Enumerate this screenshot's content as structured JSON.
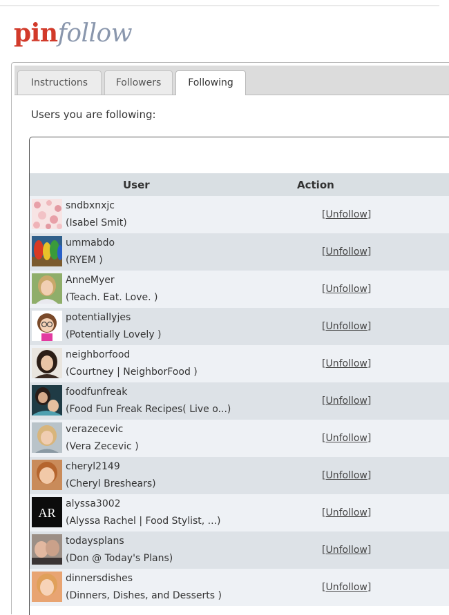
{
  "logo": {
    "part1": "pin",
    "part2": "follow"
  },
  "tabs": [
    {
      "label": "Instructions",
      "active": false
    },
    {
      "label": "Followers",
      "active": false
    },
    {
      "label": "Following",
      "active": true
    }
  ],
  "intro_text": "Users you are following:",
  "table": {
    "headers": {
      "user": "User",
      "action": "Action"
    },
    "action_label": "[Unfollow]",
    "rows": [
      {
        "username": "sndbxnxjc",
        "fullname": "(Isabel Smit)",
        "avatar": "floral-pattern"
      },
      {
        "username": "ummabdo",
        "fullname": "(RYEM )",
        "avatar": "parrots-photo"
      },
      {
        "username": "AnneMyer",
        "fullname": "(Teach. Eat. Love. )",
        "avatar": "woman-photo"
      },
      {
        "username": "potentiallyjes",
        "fullname": "(Potentially Lovely )",
        "avatar": "cartoon-girl"
      },
      {
        "username": "neighborfood",
        "fullname": "(Courtney | NeighborFood )",
        "avatar": "woman-photo"
      },
      {
        "username": "foodfunfreak",
        "fullname": "(Food Fun Freak Recipes( Live o...)",
        "avatar": "mother-child-photo"
      },
      {
        "username": "verazecevic",
        "fullname": "(Vera Zecevic )",
        "avatar": "woman-photo"
      },
      {
        "username": "cheryl2149",
        "fullname": "(Cheryl Breshears)",
        "avatar": "woman-photo"
      },
      {
        "username": "alyssa3002",
        "fullname": "(Alyssa Rachel | Food Stylist, ...)",
        "avatar": "ar-monogram",
        "avatar_text": "AR"
      },
      {
        "username": "todaysplans",
        "fullname": "(Don @ Today's Plans)",
        "avatar": "couple-photo"
      },
      {
        "username": "dinnersdishes",
        "fullname": "(Dinners, Dishes, and Desserts )",
        "avatar": "woman-photo"
      }
    ]
  }
}
